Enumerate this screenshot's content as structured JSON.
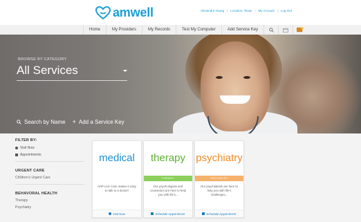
{
  "header": {
    "logo_text": "amwell",
    "user_name": "Alexandra Young",
    "location": "Location: Texas",
    "my_account": "My Account",
    "log_out": "Log Out",
    "separator": "|"
  },
  "nav": {
    "items": [
      "Home",
      "My Providers",
      "My Records",
      "Test My Computer",
      "Add Service Key"
    ]
  },
  "hero": {
    "browse_label": "BROWSE BY CATEGORY",
    "category": "All Services",
    "search_by_name": "Search by Name",
    "add_service_key": "Add a Service Key"
  },
  "sidebar": {
    "filter_by": "FILTER BY:",
    "options": [
      "Visit Now",
      "Appointments"
    ],
    "urgent_care_head": "URGENT CARE",
    "urgent_care_items": [
      "Children's Urgent Care"
    ],
    "behavioral_head": "BEHAVORAL HEALTH",
    "behavioral_items": [
      "Therapy",
      "Psychiatry"
    ]
  },
  "cards": [
    {
      "title": "medical",
      "title_color": "#1a8fd0",
      "band_label": "",
      "band_color": "#ffffff",
      "description": "AHP Live Care makes it easy to talk to a doctor!",
      "action": "Visit Now"
    },
    {
      "title": "therapy",
      "title_color": "#5fb02e",
      "band_label": "THERAPY",
      "band_color": "#8ccf5a",
      "description": "Our psychologists and counselors are here to help you with life's...",
      "action": "Schedule Appointment"
    },
    {
      "title": "psychiatry",
      "title_color": "#f08a24",
      "band_label": "PSYCHIATRY",
      "band_color": "#f5b26a",
      "description": "Our psychiatrists are here to help you with life's challenges...",
      "action": "Schedule Appointment"
    }
  ]
}
